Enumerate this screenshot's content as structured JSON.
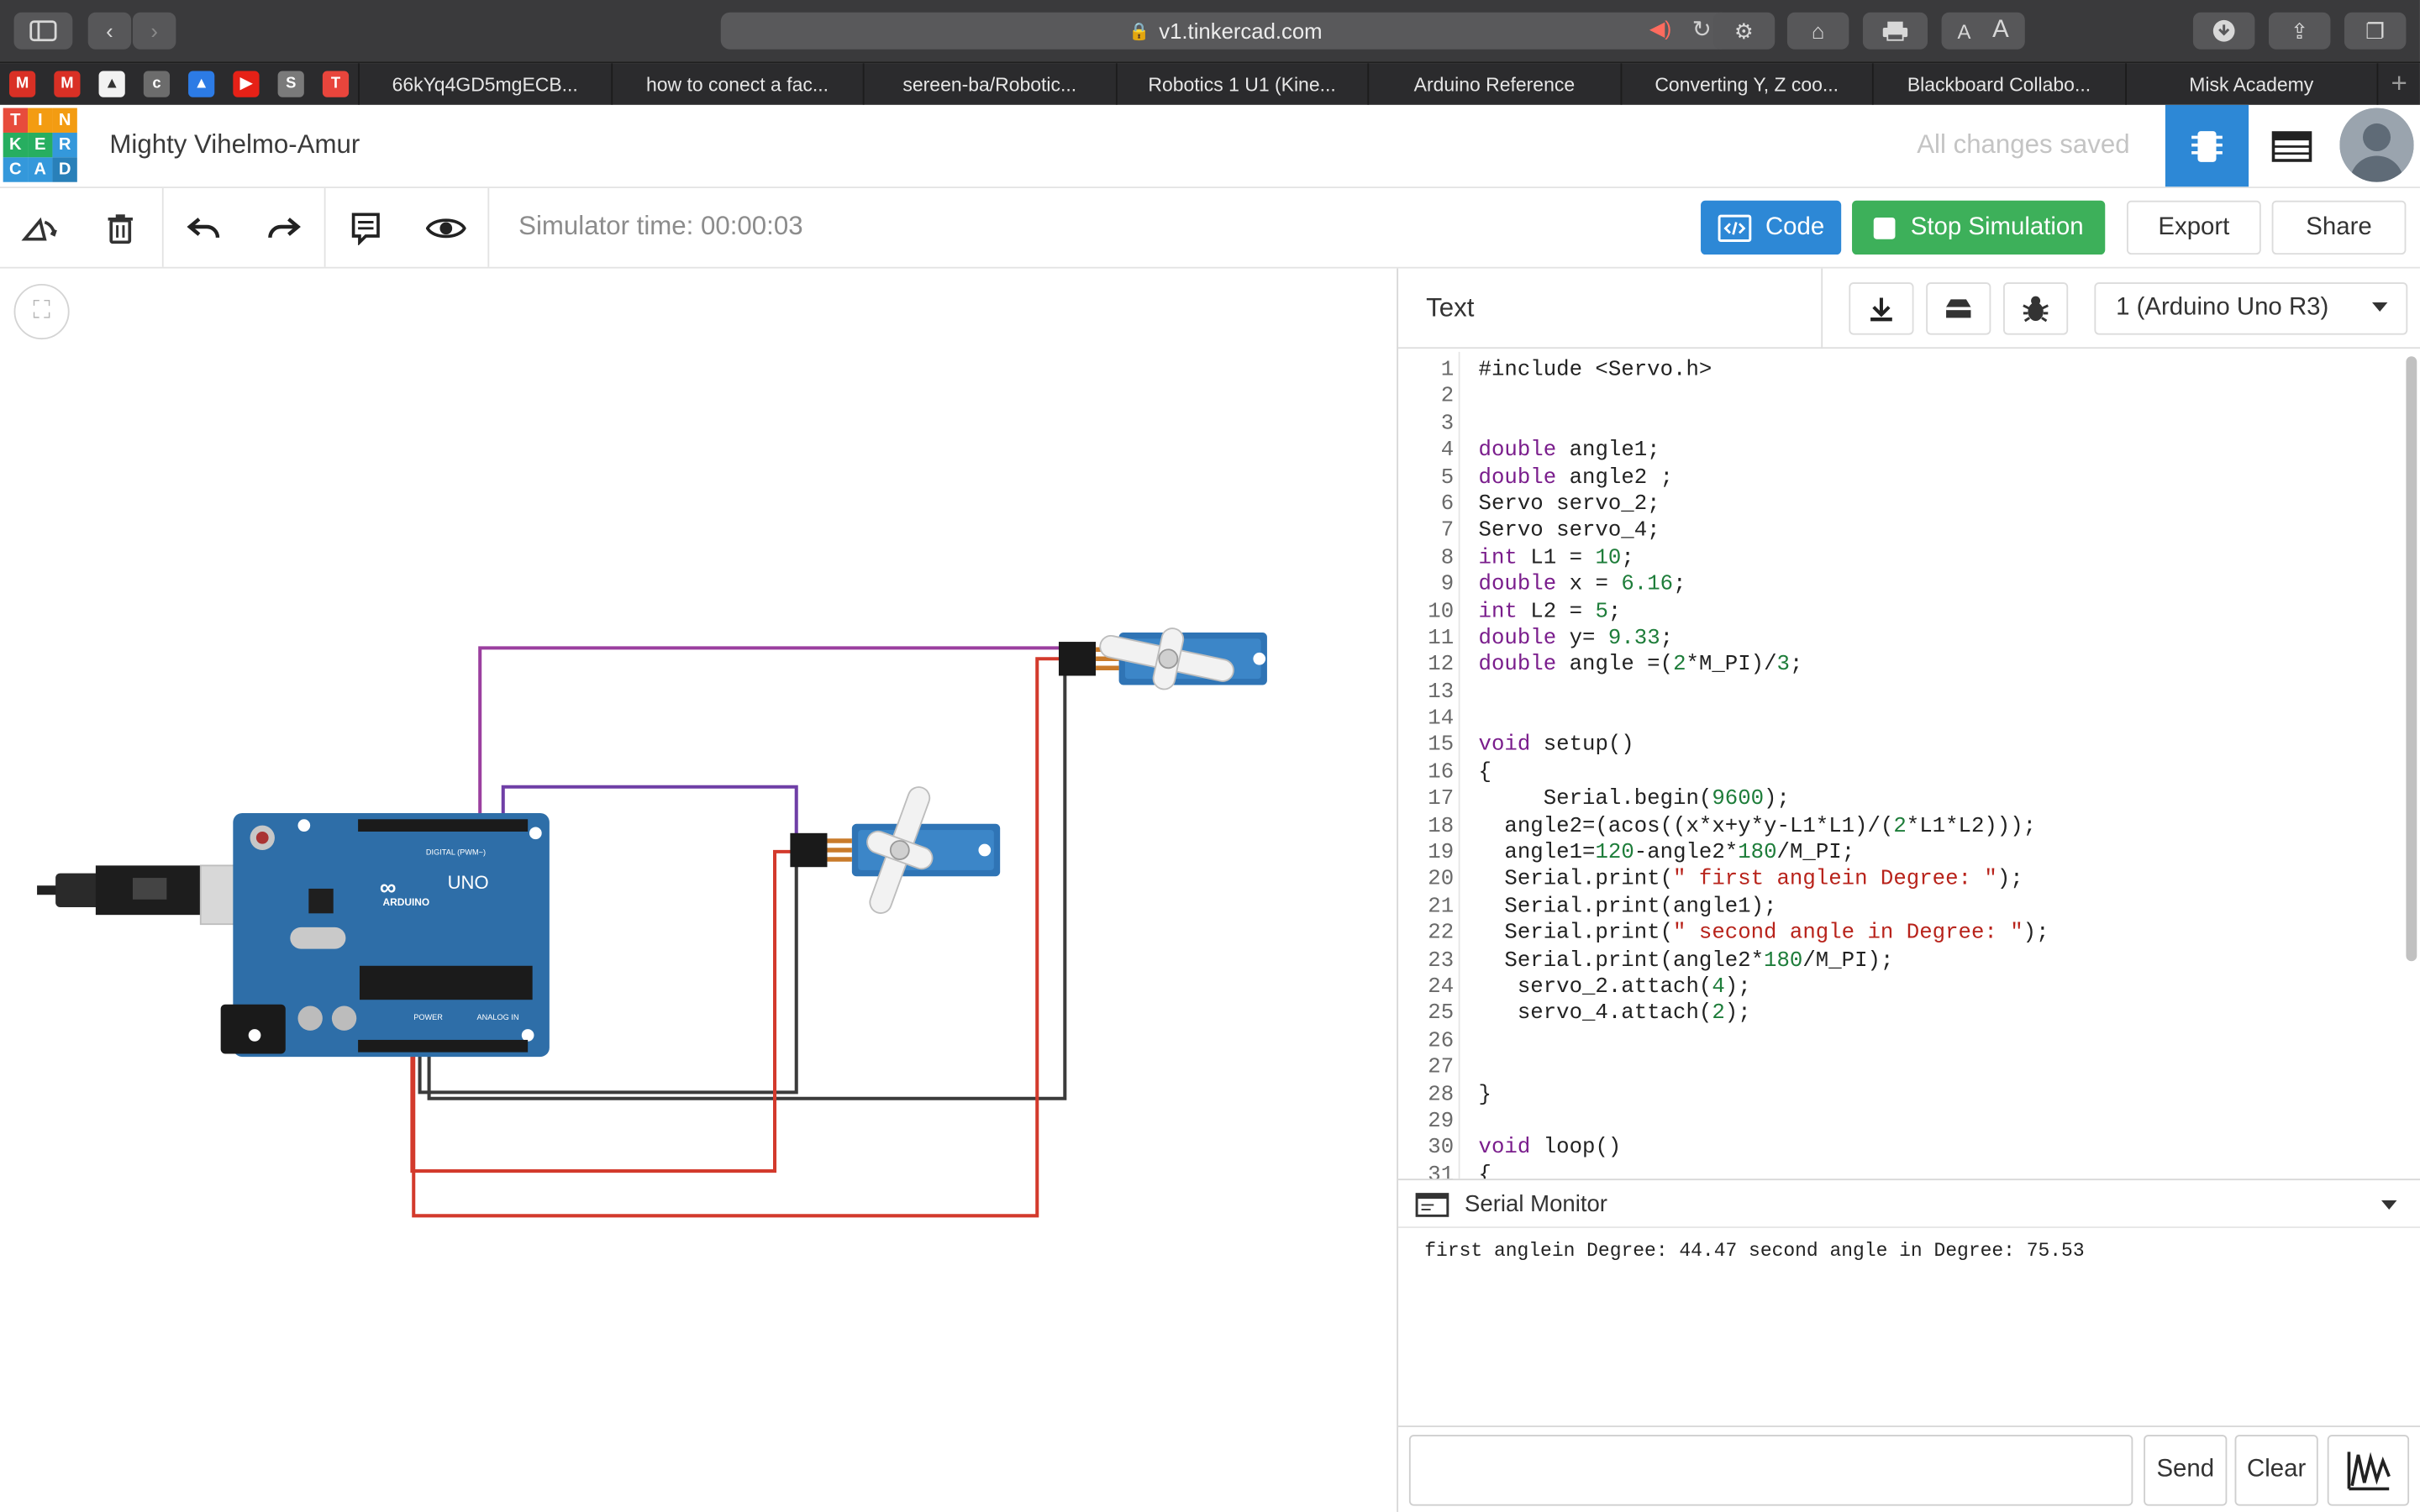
{
  "browser": {
    "url": "v1.tinkercad.com",
    "text_small": "A",
    "text_large": "A",
    "tabs": [
      "66kYq4GD5mgECB...",
      "how to conect a fac...",
      "sereen-ba/Robotic...",
      "Robotics 1 U1 (Kine...",
      "Arduino Reference",
      "Converting Y, Z coo...",
      "Blackboard Collabo...",
      "Misk Academy"
    ],
    "favicons": [
      {
        "name": "gmail-icon",
        "color": "#d93025",
        "glyph": "M"
      },
      {
        "name": "gmail-icon-2",
        "color": "#d93025",
        "glyph": "M"
      },
      {
        "name": "mountain-icon",
        "color": "#f2f2f2",
        "glyph": "▲"
      },
      {
        "name": "cisco-icon",
        "color": "#6c6c6c",
        "glyph": "c"
      },
      {
        "name": "drive-icon",
        "color": "#2c7be5",
        "glyph": "▲"
      },
      {
        "name": "youtube-icon",
        "color": "#e62117",
        "glyph": "▶"
      },
      {
        "name": "s-icon",
        "color": "#7a7a7a",
        "glyph": "S"
      },
      {
        "name": "tinkercad-icon",
        "color": "#e8453c",
        "glyph": "T"
      }
    ]
  },
  "app": {
    "logo_letters": [
      "T",
      "I",
      "N",
      "K",
      "E",
      "R",
      "C",
      "A",
      "D"
    ],
    "logo_colors": [
      "#e74c3c",
      "#f39c12",
      "#f39c12",
      "#27ae60",
      "#27ae60",
      "#3498db",
      "#3498db",
      "#3498db",
      "#2980b9"
    ],
    "project_name": "Mighty Vihelmo-Amur",
    "save_status": "All changes saved"
  },
  "toolbar": {
    "sim_time": "Simulator time: 00:00:03",
    "code_label": "Code",
    "stop_label": "Stop Simulation",
    "export_label": "Export",
    "share_label": "Share"
  },
  "panel": {
    "mode": "Text",
    "device": "1 (Arduino Uno R3)"
  },
  "code_lines": [
    [
      [
        "#include <Servo.h>",
        ""
      ]
    ],
    [
      [
        "",
        ""
      ]
    ],
    [
      [
        "",
        ""
      ]
    ],
    [
      [
        "double",
        "k"
      ],
      [
        " angle1;",
        ""
      ]
    ],
    [
      [
        "double",
        "k"
      ],
      [
        " angle2 ;",
        ""
      ]
    ],
    [
      [
        "Servo servo_2;",
        ""
      ]
    ],
    [
      [
        "Servo servo_4;",
        ""
      ]
    ],
    [
      [
        "int",
        "k"
      ],
      [
        " L1 = ",
        ""
      ],
      [
        "10",
        "n"
      ],
      [
        ";",
        ""
      ]
    ],
    [
      [
        "double",
        "k"
      ],
      [
        " x = ",
        ""
      ],
      [
        "6.16",
        "n"
      ],
      [
        ";",
        ""
      ]
    ],
    [
      [
        "int",
        "k"
      ],
      [
        " L2 = ",
        ""
      ],
      [
        "5",
        "n"
      ],
      [
        ";",
        ""
      ]
    ],
    [
      [
        "double",
        "k"
      ],
      [
        " y= ",
        ""
      ],
      [
        "9.33",
        "n"
      ],
      [
        ";",
        ""
      ]
    ],
    [
      [
        "double",
        "k"
      ],
      [
        " angle =(",
        ""
      ],
      [
        "2",
        "n"
      ],
      [
        "*M_PI)/",
        ""
      ],
      [
        "3",
        "n"
      ],
      [
        ";",
        ""
      ]
    ],
    [
      [
        "",
        ""
      ]
    ],
    [
      [
        "",
        ""
      ]
    ],
    [
      [
        "void",
        "k"
      ],
      [
        " setup()",
        ""
      ]
    ],
    [
      [
        "{",
        ""
      ]
    ],
    [
      [
        "     Serial.begin(",
        ""
      ],
      [
        "9600",
        "n"
      ],
      [
        ");",
        ""
      ]
    ],
    [
      [
        "  angle2=(acos((x*x+y*y-L1*L1)/(",
        ""
      ],
      [
        "2",
        "n"
      ],
      [
        "*L1*L2)));",
        ""
      ]
    ],
    [
      [
        "  angle1=",
        ""
      ],
      [
        "120",
        "n"
      ],
      [
        "-angle2*",
        ""
      ],
      [
        "180",
        "n"
      ],
      [
        "/M_PI;",
        ""
      ]
    ],
    [
      [
        "  Serial.print(",
        ""
      ],
      [
        "\" first anglein Degree: \"",
        "s"
      ],
      [
        ");",
        ""
      ]
    ],
    [
      [
        "  Serial.print(angle1);",
        ""
      ]
    ],
    [
      [
        "  Serial.print(",
        ""
      ],
      [
        "\" second angle in Degree: \"",
        "s"
      ],
      [
        ");",
        ""
      ]
    ],
    [
      [
        "  Serial.print(angle2*",
        ""
      ],
      [
        "180",
        "n"
      ],
      [
        "/M_PI);",
        ""
      ]
    ],
    [
      [
        "   servo_2.attach(",
        ""
      ],
      [
        "4",
        "n"
      ],
      [
        ");",
        ""
      ]
    ],
    [
      [
        "   servo_4.attach(",
        ""
      ],
      [
        "2",
        "n"
      ],
      [
        ");",
        ""
      ]
    ],
    [
      [
        "",
        ""
      ]
    ],
    [
      [
        "",
        ""
      ]
    ],
    [
      [
        "}",
        ""
      ]
    ],
    [
      [
        "",
        ""
      ]
    ],
    [
      [
        "void",
        "k"
      ],
      [
        " loop()",
        ""
      ]
    ],
    [
      [
        "{",
        ""
      ]
    ]
  ],
  "serial": {
    "title": "Serial Monitor",
    "output": "first anglein Degree: 44.47 second angle in Degree: 75.53",
    "send_label": "Send",
    "clear_label": "Clear"
  },
  "board": {
    "brand": "ARDUINO",
    "model": "UNO",
    "digital_label": "DIGITAL (PWM~)",
    "power_label": "POWER",
    "analog_label": "ANALOG IN"
  },
  "colors": {
    "code_blue": "#2d88d6",
    "stop_green": "#3db05a",
    "wire_purple": "#9b3f9f",
    "wire_violet": "#6f3fa6",
    "wire_red": "#d33a2c",
    "wire_black": "#3b3b3b",
    "board_blue": "#2e6ea8"
  }
}
